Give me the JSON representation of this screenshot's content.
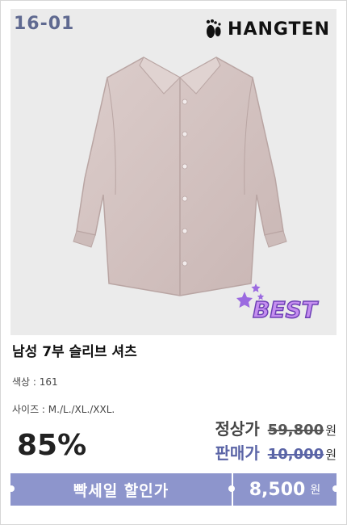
{
  "product": {
    "code": "16-01",
    "brand": "HANGTEN",
    "badge": "BEST",
    "title": "남성 7부 슬리브 셔츠",
    "color_label": "색상 : 161",
    "size_label": "사이즈 : M./L./XL./XXL."
  },
  "pricing": {
    "discount": "85%",
    "regular_label": "정상가",
    "regular_price": "59,800",
    "sale_label": "판매가",
    "sale_price": "10,000",
    "currency": "원",
    "banner_text": "빡세일 할인가",
    "final_price": "8,500"
  },
  "colors": {
    "accent": "#8d95cc",
    "code_text": "#5f6990",
    "shirt": "#d4c3c1",
    "best_text": "#c58ef0"
  }
}
